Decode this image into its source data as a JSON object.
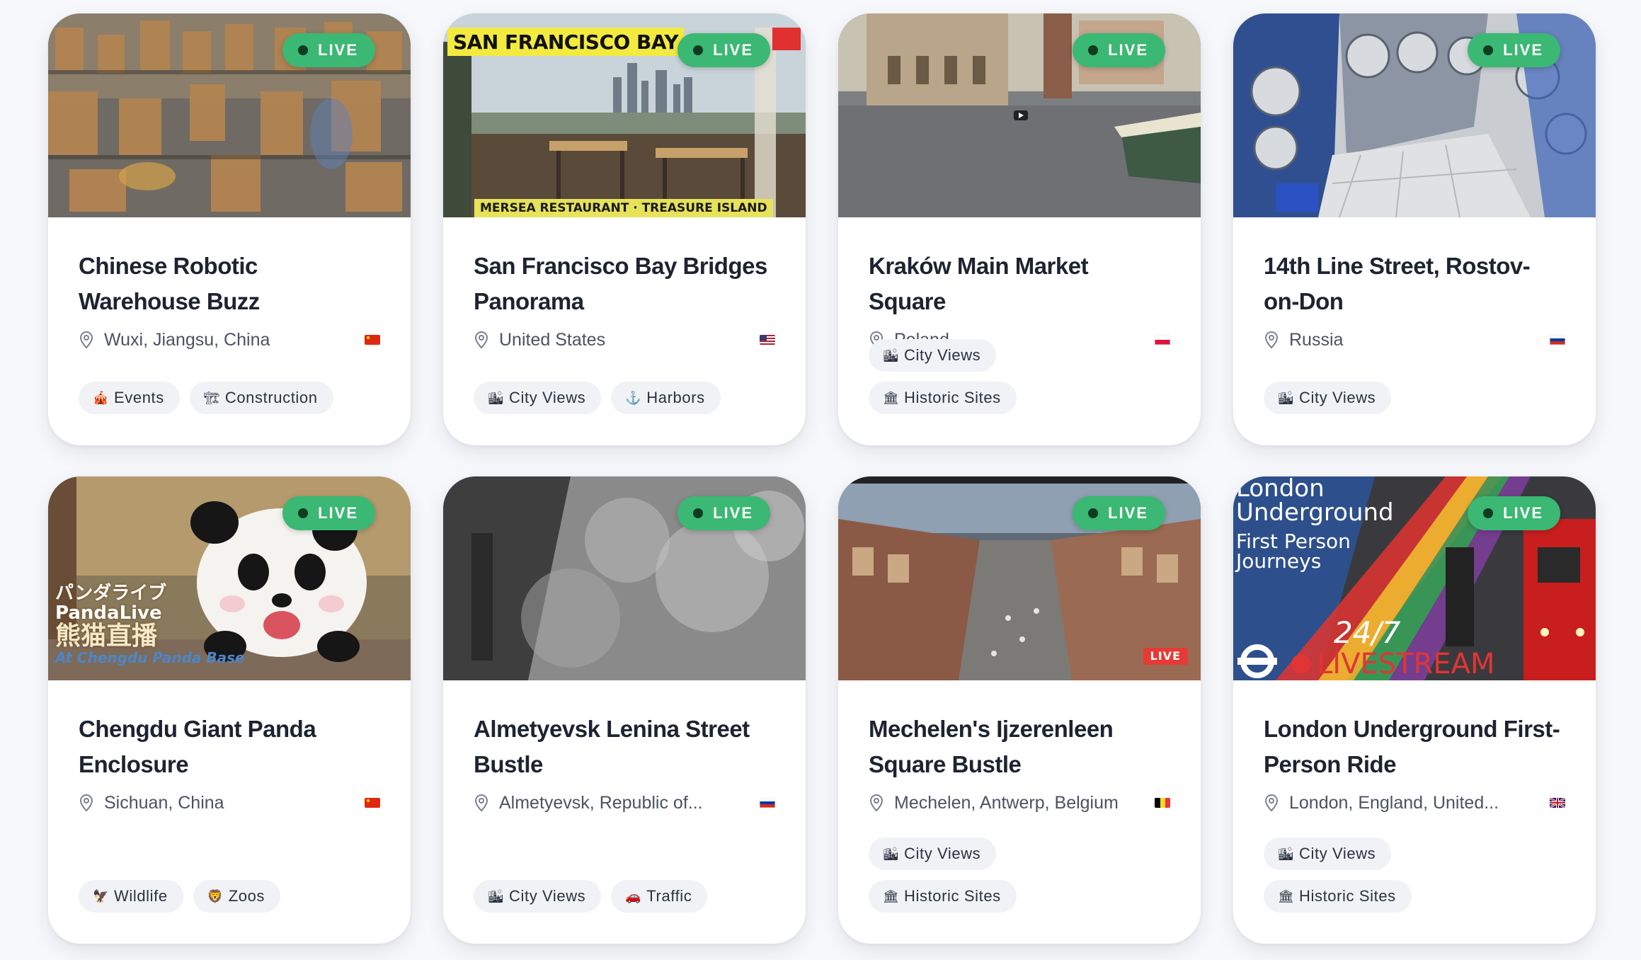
{
  "live_label": "LIVE",
  "cards": [
    {
      "title": "Chinese Robotic Warehouse Buzz",
      "location": "Wuxi, Jiangsu, China",
      "flag": "cn",
      "tags": [
        {
          "icon": "🎪",
          "label": "Events"
        },
        {
          "icon": "🏗",
          "label": "Construction"
        }
      ]
    },
    {
      "title": "San Francisco Bay Bridges Panorama",
      "location": "United States",
      "flag": "us",
      "thumb_top": "SAN FRANCISCO BAY",
      "thumb_bottom": "MERSEA RESTAURANT · TREASURE ISLAND",
      "tags": [
        {
          "icon": "🏙",
          "label": "City Views"
        },
        {
          "icon": "⚓",
          "label": "Harbors"
        }
      ]
    },
    {
      "title": "Kraków Main Market Square",
      "location": "Poland",
      "flag": "pl",
      "tags": [
        {
          "icon": "🏙",
          "label": "City Views"
        },
        {
          "icon": "🏛",
          "label": "Historic Sites"
        }
      ]
    },
    {
      "title": "14th Line Street, Rostov-on-Don",
      "location": "Russia",
      "flag": "ru",
      "tags": [
        {
          "icon": "🏙",
          "label": "City Views"
        }
      ]
    },
    {
      "title": "Chengdu Giant Panda Enclosure",
      "location": "Sichuan, China",
      "flag": "cn",
      "thumb_jp": "パンダライブ",
      "thumb_en": "PandaLive",
      "thumb_zh": "熊猫直播",
      "thumb_sub": "At Chengdu Panda Base",
      "tags": [
        {
          "icon": "🦅",
          "label": "Wildlife"
        },
        {
          "icon": "🦁",
          "label": "Zoos"
        }
      ]
    },
    {
      "title": "Almetyevsk Lenina Street Bustle",
      "location": "Almetyevsk, Republic of...",
      "flag": "ru",
      "tags": [
        {
          "icon": "🏙",
          "label": "City Views"
        },
        {
          "icon": "🚗",
          "label": "Traffic"
        }
      ]
    },
    {
      "title": "Mechelen's Ijzerenleen Square Bustle",
      "location": "Mechelen, Antwerp, Belgium",
      "flag": "be",
      "thumb_live": "LIVE",
      "tags": [
        {
          "icon": "🏙",
          "label": "City Views"
        },
        {
          "icon": "🏛",
          "label": "Historic Sites"
        }
      ]
    },
    {
      "title": "London Underground First-Person Ride",
      "location": "London, England, United...",
      "flag": "gb",
      "thumb_l1": "London",
      "thumb_l2": "Underground",
      "thumb_l3": "First Person",
      "thumb_l4": "Journeys",
      "thumb_l5": "24/7",
      "thumb_l6": "LIVESTREAM",
      "tags": [
        {
          "icon": "🏙",
          "label": "City Views"
        },
        {
          "icon": "🏛",
          "label": "Historic Sites"
        }
      ]
    }
  ],
  "colors": {
    "live_badge": "#3bb873",
    "tag_bg": "#f0f2f6",
    "card_bg": "#ffffff",
    "page_bg": "#f7f8fb"
  }
}
